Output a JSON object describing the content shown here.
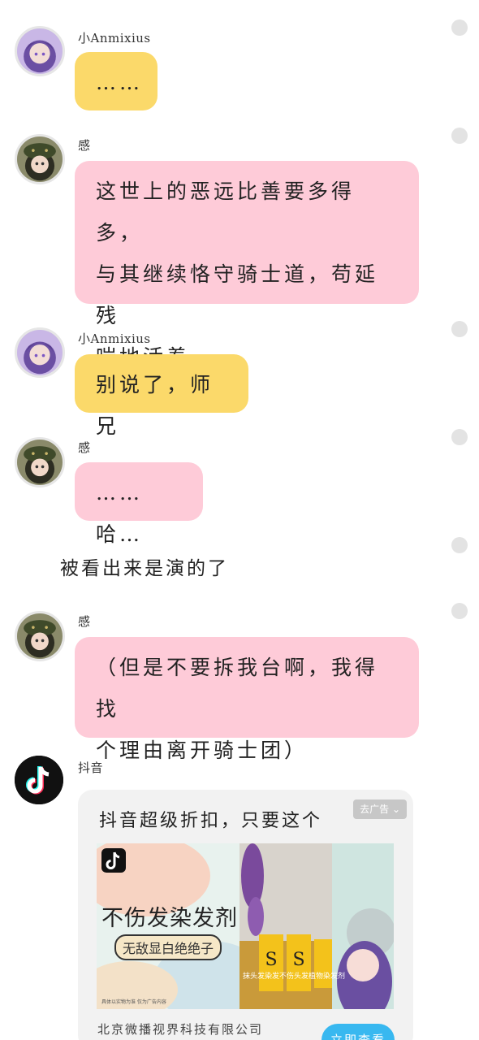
{
  "messages": [
    {
      "sender": "小Anmixius",
      "text": "……",
      "color": "yellow",
      "avatar": "purple-hair-girl-avatar"
    },
    {
      "sender": "感",
      "text_lines": [
        "这世上的恶远比善要多得多，",
        "与其继续恪守骑士道，苟延残",
        "喘地活着……"
      ],
      "color": "pink",
      "avatar": "beret-boy-avatar"
    },
    {
      "sender": "小Anmixius",
      "text": "别说了，师兄",
      "color": "yellow",
      "avatar": "purple-hair-girl-avatar"
    },
    {
      "sender": "感",
      "text": "……哈…",
      "color": "pink",
      "avatar": "beret-boy-avatar"
    },
    {
      "narration": "被看出来是演的了"
    },
    {
      "sender": "感",
      "text_lines": [
        "（但是不要拆我台啊，我得找",
        "个理由离开骑士团）"
      ],
      "color": "pink",
      "avatar": "beret-boy-avatar"
    }
  ],
  "ad": {
    "sender": "抖音",
    "title": "抖音超级折扣，只要这个",
    "tag": "去广告 ⌄",
    "image_headline": "不伤发染发剂",
    "image_subline": "无敌显白绝绝子",
    "image_caption": "抹头发染发不伤头发植物染发剂",
    "image_footnote": "具体以实物为准 仅为广告内容",
    "company": "北京微播视界科技有限公司",
    "cta": "立即查看"
  },
  "colors": {
    "yellow_bubble": "#fbd96a",
    "pink_bubble": "#fecbd8",
    "cta_blue": "#38b8f0"
  }
}
